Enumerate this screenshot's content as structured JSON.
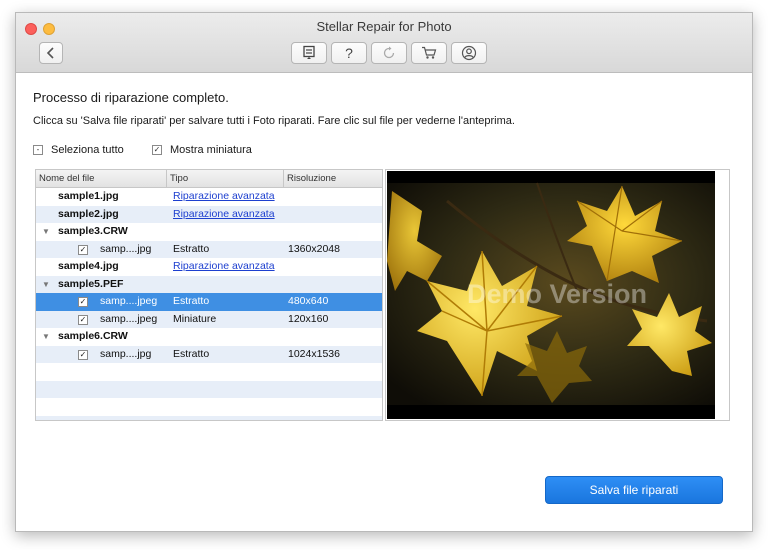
{
  "window": {
    "title": "Stellar Repair for Photo"
  },
  "toolbar": {
    "back_icon": "chevron-left-icon",
    "icons": [
      "save-list-icon",
      "help-icon",
      "refresh-icon",
      "cart-icon",
      "user-icon"
    ],
    "help_label": "?"
  },
  "main": {
    "heading": "Processo di riparazione completo.",
    "instructions": "Clicca su 'Salva file riparati' per salvare tutti i Foto riparati. Fare clic sul file per vederne l'anteprima.",
    "select_all_label": "Seleziona tutto",
    "select_all_mark": "-",
    "thumbnail_label": "Mostra miniatura",
    "thumbnail_mark": "✓"
  },
  "table": {
    "columns": [
      "Nome del file",
      "Tipo",
      "Risoluzione"
    ],
    "rows": [
      {
        "kind": "file",
        "name": "sample1.jpg",
        "type": "Riparazione avanzata",
        "resolution": ""
      },
      {
        "kind": "file",
        "name": "sample2.jpg",
        "type": "Riparazione avanzata",
        "resolution": ""
      },
      {
        "kind": "group",
        "name": "sample3.CRW",
        "type": "",
        "resolution": ""
      },
      {
        "kind": "child",
        "check": "✓",
        "name": "samp....jpg",
        "type": "Estratto",
        "resolution": "1360x2048"
      },
      {
        "kind": "file",
        "name": "sample4.jpg",
        "type": "Riparazione avanzata",
        "resolution": ""
      },
      {
        "kind": "group",
        "name": "sample5.PEF",
        "type": "",
        "resolution": ""
      },
      {
        "kind": "child",
        "check": "✓",
        "name": "samp....jpeg",
        "type": "Estratto",
        "resolution": "480x640",
        "selected": true
      },
      {
        "kind": "child",
        "check": "✓",
        "name": "samp....jpeg",
        "type": "Miniature",
        "resolution": "120x160"
      },
      {
        "kind": "group",
        "name": "sample6.CRW",
        "type": "",
        "resolution": ""
      },
      {
        "kind": "child",
        "check": "✓",
        "name": "samp....jpg",
        "type": "Estratto",
        "resolution": "1024x1536"
      },
      {
        "kind": "empty"
      },
      {
        "kind": "empty"
      },
      {
        "kind": "empty"
      },
      {
        "kind": "empty"
      }
    ]
  },
  "preview": {
    "watermark": "Demo Version"
  },
  "footer": {
    "save_label": "Salva file riparati"
  },
  "colors": {
    "accent": "#1a76de",
    "selection": "#3f8fe3",
    "link": "#1d3fcf"
  }
}
